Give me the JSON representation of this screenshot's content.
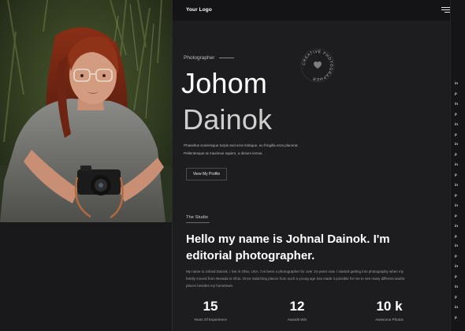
{
  "header": {
    "logo": "Your Logo",
    "menu_icon": "hamburger-icon"
  },
  "hero": {
    "role": "Photographer",
    "first_name": "Johom",
    "last_name": "Dainok",
    "badge_text": "CREATIVE PHOTOGRAPHER",
    "description": "Phasellus scelerisque turpis sed eros tristique, eu fringilla eros placerat. Pellentesque at maximus sapien, a dictum lectus.",
    "cta": "View My Profile"
  },
  "studio": {
    "label": "The Studio",
    "headline": "Hello my name is Johnal Dainok. I'm editorial photographer.",
    "bio": "My name is Johnal Dainok. I live in Ohio, USA. I've been a photographer for over 15 years now. I started getting into photography when my family moved from Nevada to Ohio. Once Switching places from such a young age has made it possible for me to see many different and/or places besides my hometown."
  },
  "stats": [
    {
      "value": "15",
      "label": "Years Of Experience"
    },
    {
      "value": "12",
      "label": "Awards Win"
    },
    {
      "value": "10 k",
      "label": "Awesome Photos"
    }
  ],
  "social_rail": [
    "in",
    "in",
    "in",
    "in",
    "in",
    "in",
    "in",
    "in",
    "in",
    "in",
    "in",
    "in",
    "in",
    "in",
    "in",
    "in",
    "in",
    "in",
    "in",
    "in",
    "in",
    "in",
    "in",
    "in",
    "in"
  ],
  "social_rail_labels": [
    "in",
    "p",
    "in",
    "p",
    "in",
    "p",
    "in",
    "p",
    "in",
    "p",
    "in",
    "p",
    "in",
    "p",
    "in",
    "p",
    "in",
    "p",
    "in",
    "p",
    "in",
    "p",
    "in",
    "p",
    "in"
  ],
  "colors": {
    "background": "#1d1d20",
    "sidebar": "#19191b",
    "topbar": "#141416",
    "accent_text": "#ffffff"
  }
}
